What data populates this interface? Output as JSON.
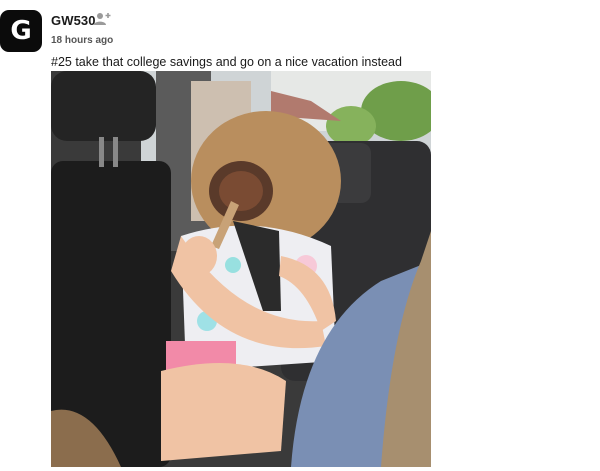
{
  "post": {
    "avatar_letter": "G",
    "username": "GW530",
    "timestamp": "18 hours ago",
    "caption": "#25 take that college savings and go on a nice vacation instead",
    "follow_icon": "person-add-icon",
    "image_subject": "photo-girl-with-plunger-in-car"
  },
  "colors": {
    "avatar_bg": "#0b0b0b",
    "text": "#1a1a1a",
    "muted": "#555555"
  }
}
